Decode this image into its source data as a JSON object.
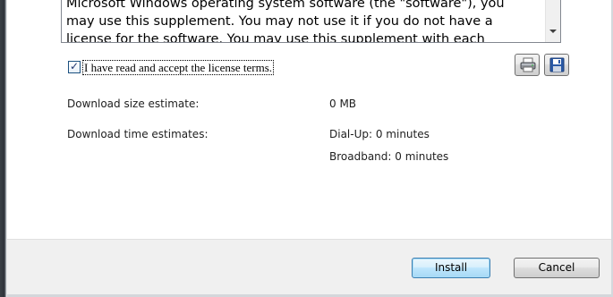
{
  "license": {
    "lines": [
      "Microsoft Windows operating system software (the \"software\"), you",
      "may use this supplement. You may not use it if you do not have a",
      "license for the software. You may use this supplement with each"
    ]
  },
  "agreement": {
    "checked": true,
    "label": "I have read and accept the license terms."
  },
  "toolbar": {
    "print_icon": "printer-icon",
    "save_icon": "floppy-disk-icon"
  },
  "download": {
    "size_label": "Download size estimate:",
    "size_value": "0 MB",
    "time_label": "Download time estimates:",
    "dialup_value": "Dial-Up: 0 minutes",
    "broadband_value": "Broadband: 0 minutes"
  },
  "footer": {
    "install_label": "Install",
    "cancel_label": "Cancel"
  },
  "colors": {
    "accent_border": "#3c7fb1",
    "footer_bg": "#f0f0f0"
  }
}
